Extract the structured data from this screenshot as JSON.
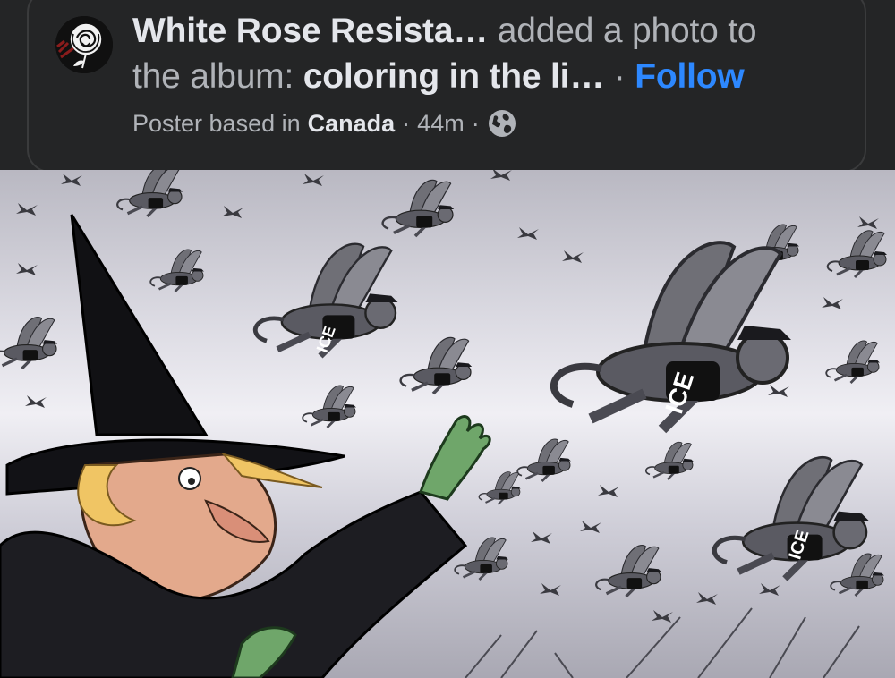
{
  "post": {
    "author": "White Rose Resista",
    "author_ellipsis": "…",
    "action": "added a photo to",
    "line2_prefix": "the album:",
    "album": "coloring in the li",
    "album_ellipsis": "…",
    "separator": "·",
    "follow_label": "Follow",
    "meta_prefix": "Poster based in",
    "meta_location": "Canada",
    "meta_time": "44m",
    "privacy_icon": "globe-icon"
  },
  "photo": {
    "monkey_label": "ICE"
  },
  "colors": {
    "background": "#242526",
    "primary_text": "#e4e6eb",
    "secondary_text": "#b0b3b8",
    "link": "#2d88ff"
  }
}
